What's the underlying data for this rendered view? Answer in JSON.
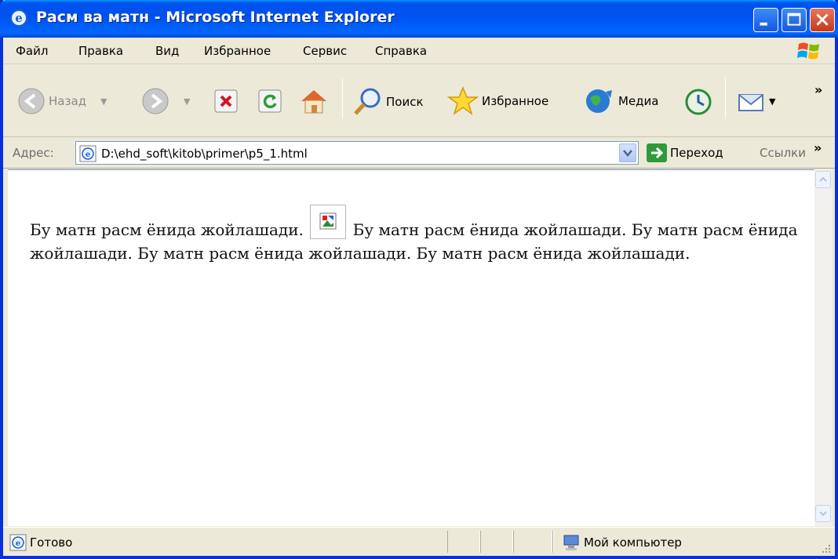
{
  "window": {
    "title": "Расм ва матн - Microsoft Internet Explorer"
  },
  "menu": {
    "items": [
      "Файл",
      "Правка",
      "Вид",
      "Избранное",
      "Сервис",
      "Справка"
    ]
  },
  "toolbar": {
    "back_label": "Назад",
    "search_label": "Поиск",
    "favorites_label": "Избранное",
    "media_label": "Медиа",
    "overflow": "»"
  },
  "address": {
    "label": "Адрес:",
    "url": "D:\\ehd_soft\\kitob\\primer\\p5_1.html",
    "go_label": "Переход",
    "links_label": "Ссылки",
    "links_overflow": "»"
  },
  "page": {
    "text_before": "Бу матн расм ёнида жойлашади.",
    "text_after": "Бу матн расм ёнида жойлашади. Бу матн расм ёнида жойлашади. Бу матн расм ёнида жойлашади. Бу матн расм ёнида жойлашади."
  },
  "status": {
    "text": "Готово",
    "zone": "Мой компьютер"
  },
  "colors": {
    "titlebar": "#0053ee",
    "chrome": "#ece9d8",
    "go_green": "#2e9a3a"
  }
}
